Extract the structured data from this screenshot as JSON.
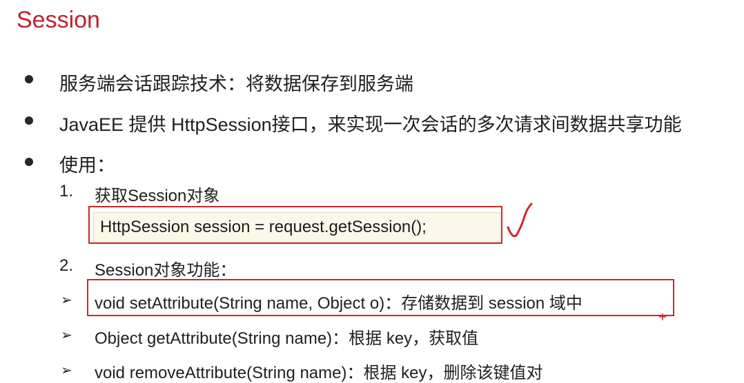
{
  "title": "Session",
  "bullets": [
    "服务端会话跟踪技术：将数据保存到服务端",
    "JavaEE 提供 HttpSession接口，来实现一次会话的多次请求间数据共享功能",
    "使用："
  ],
  "steps": [
    {
      "number": "1.",
      "label": "获取Session对象"
    },
    {
      "number": "2.",
      "label": "Session对象功能："
    }
  ],
  "code": "HttpSession session = request.getSession();",
  "methods": [
    "void setAttribute(String name, Object o)：存储数据到 session 域中",
    "Object getAttribute(String name)：根据 key，获取值",
    " void removeAttribute(String name)：根据 key，删除该键值对"
  ],
  "colors": {
    "title": "#c0202a",
    "highlight_box": "#d0242e",
    "code_background": "#fbf8ea"
  },
  "icons": {
    "bullet": "filled-circle",
    "method_marker": "arrowhead-right",
    "annotation": "red-checkmark"
  }
}
